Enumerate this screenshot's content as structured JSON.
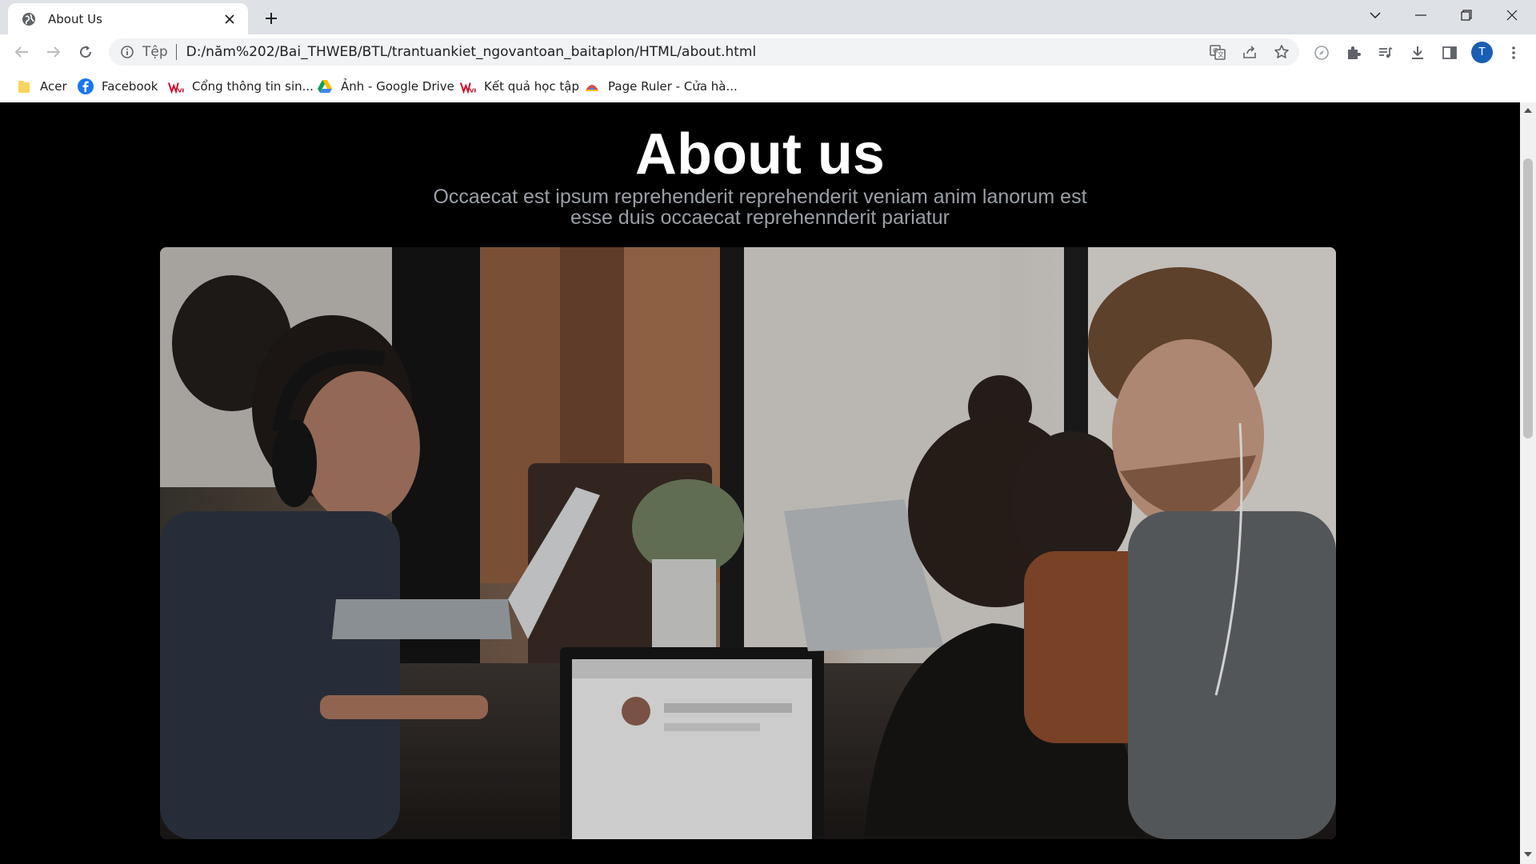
{
  "browser": {
    "tab_title": "About Us",
    "address": {
      "scheme": "Tệp",
      "url": "D:/năm%202/Bai_THWEB/BTL/trantuankiet_ngovantoan_baitaplon/HTML/about.html"
    },
    "profile_initial": "T",
    "bookmarks": [
      {
        "label": "Acer",
        "icon": "folder-icon"
      },
      {
        "label": "Facebook",
        "icon": "facebook-icon"
      },
      {
        "label": "Cổng thông tin sin...",
        "icon": "vu-logo-icon"
      },
      {
        "label": "Ảnh - Google Drive",
        "icon": "google-drive-icon"
      },
      {
        "label": "Kết quả học tập",
        "icon": "vu-logo-icon"
      },
      {
        "label": "Page Ruler - Cửa hà...",
        "icon": "page-ruler-icon"
      }
    ]
  },
  "page": {
    "title": "About us",
    "subtitle": "Occaecat est ipsum reprehenderit reprehenderit veniam anim lanorum est esse duis occaecat reprehennderit pariatur"
  },
  "colors": {
    "page_background": "#000000",
    "title": "#ffffff",
    "subtitle": "#9a9fa6",
    "tab_strip": "#dee1e6",
    "avatar": "#1a5fb4"
  }
}
